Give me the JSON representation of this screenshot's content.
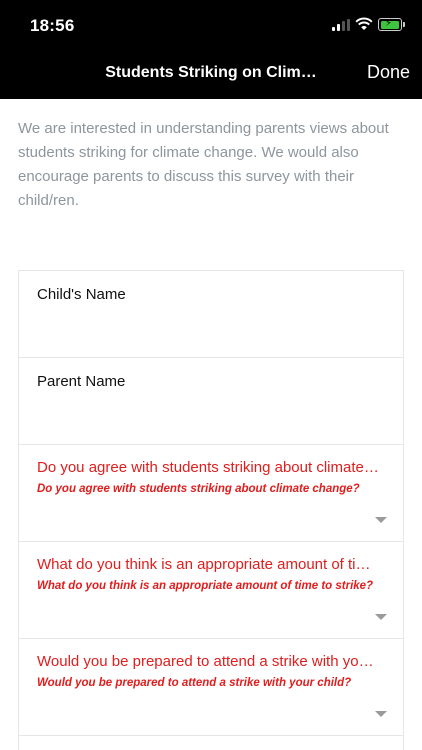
{
  "status_bar": {
    "time": "18:56"
  },
  "nav": {
    "title": "Students Striking on Clim…",
    "done_label": "Done"
  },
  "intro": {
    "text": "We are interested in understanding parents views about students striking for climate change.  We would also encourage parents to discuss this survey with their child/ren."
  },
  "fields": [
    {
      "label": "Child's Name"
    },
    {
      "label": "Parent Name"
    }
  ],
  "questions": [
    {
      "label": "Do you agree with students striking about climate change?",
      "sublabel": "Do you agree with students striking about climate change?"
    },
    {
      "label": "What do you think is an appropriate amount of time to strike?",
      "sublabel": "What do you think is an appropriate amount of time to strike?"
    },
    {
      "label": "Would you be prepared to attend a strike with your child?",
      "sublabel": "Would you be prepared to attend a strike with your child?"
    }
  ],
  "colors": {
    "required_accent": "#e11d1d",
    "intro_text": "#8e959c",
    "battery": "#3ec43e"
  },
  "icons": [
    "signal-icon",
    "wifi-icon",
    "battery-charging-icon",
    "chevron-down-icon"
  ]
}
